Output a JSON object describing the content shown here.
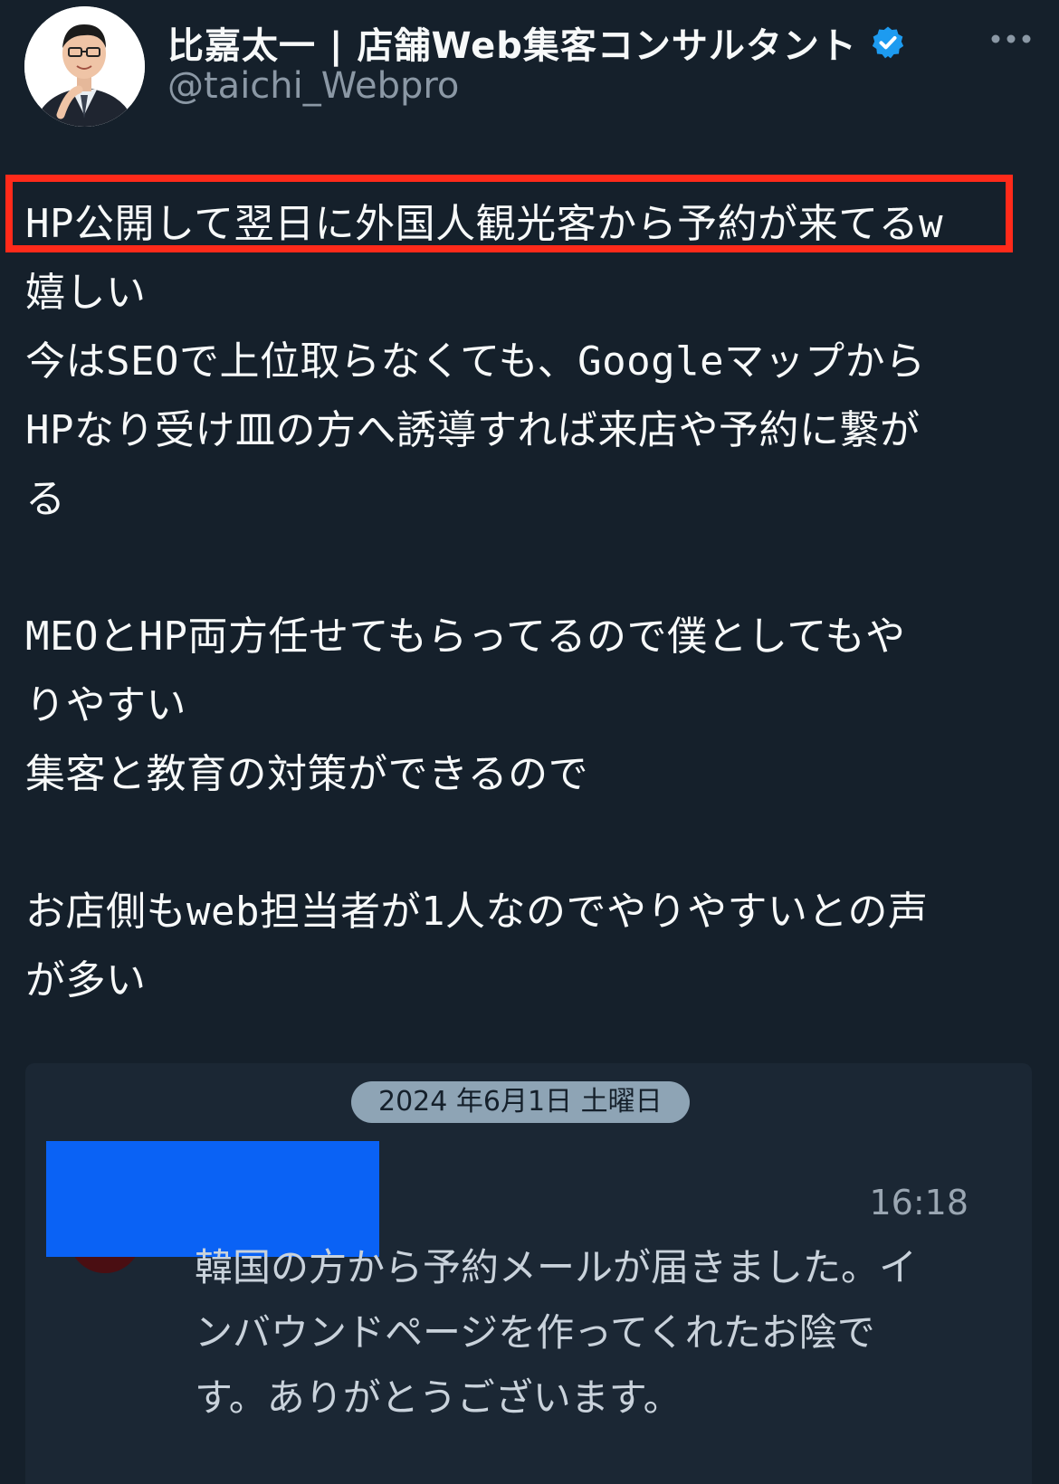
{
  "header": {
    "display_name": "比嘉太一 | 店舗Web集客コンサルタント",
    "handle": "@taichi_Webpro",
    "verified_icon": "verified-badge-icon",
    "more_icon": "more-dots-icon"
  },
  "tweet": {
    "text": "HP公開して翌日に外国人観光客から予約が来てるw\n嬉しい\n今はSEOで上位取らなくても、Googleマップから\nHPなり受け皿の方へ誘導すれば来店や予約に繋が\nる\n\nMEOとHP両方任せてもらってるので僕としてもや\nりやすい\n集客と教育の対策ができるので\n\nお店側もweb担当者が1人なのでやりやすいとの声\nが多い"
  },
  "embed": {
    "date": "2024 年6月1日 土曜日",
    "time": "16:18",
    "message": "韓国の方から予約メールが届きました。イ\nンバウンドページを作ってくれたお陰で\nす。ありがとうございます。"
  },
  "colors": {
    "background": "#15202b",
    "highlight": "#ff2a1a",
    "verified": "#1d9bf0",
    "redaction": "#0a62f5"
  }
}
